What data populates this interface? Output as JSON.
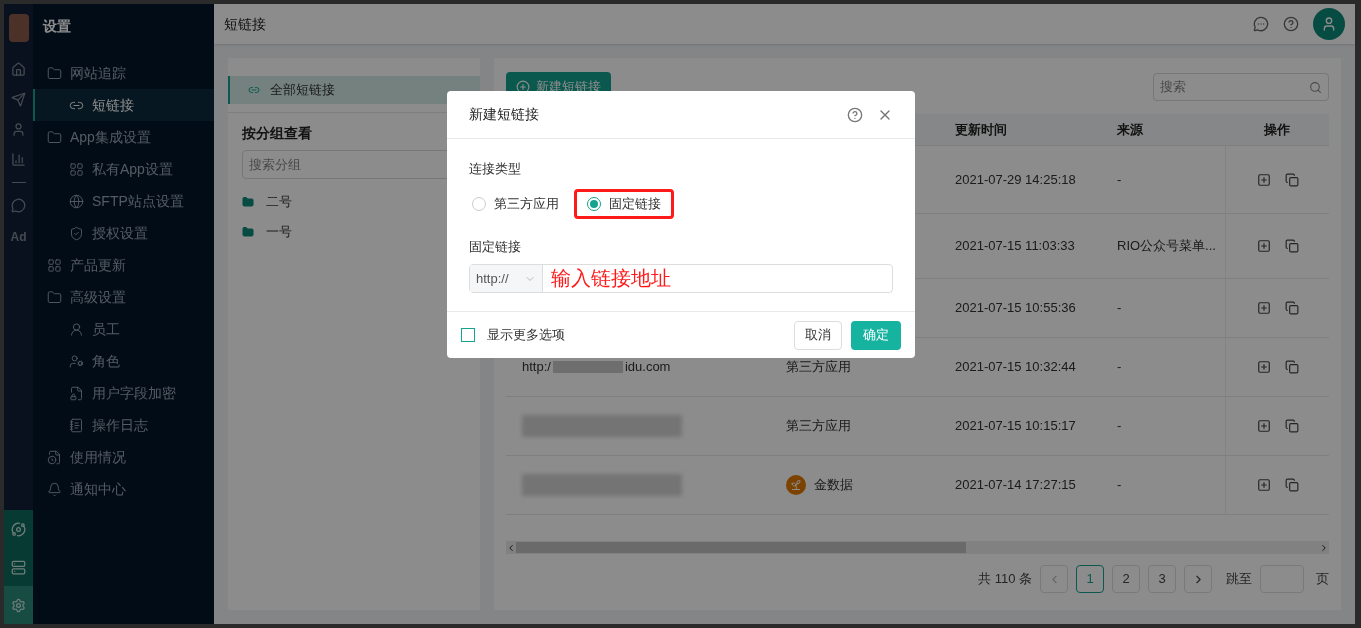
{
  "rail": {
    "ad_label": "Ad",
    "bottom_buttons": [
      {
        "selected": false
      },
      {
        "selected": false
      },
      {
        "selected": true
      }
    ]
  },
  "sidebar": {
    "title": "设置",
    "items": [
      {
        "label": "网站追踪",
        "selected": false,
        "children": [
          {
            "label": "短链接",
            "selected": true
          }
        ]
      },
      {
        "label": "App集成设置",
        "selected": false,
        "children": [
          {
            "label": "私有App设置",
            "selected": false
          },
          {
            "label": "SFTP站点设置",
            "selected": false
          },
          {
            "label": "授权设置",
            "selected": false
          }
        ]
      },
      {
        "label": "产品更新",
        "selected": false
      },
      {
        "label": "高级设置",
        "selected": false,
        "children": [
          {
            "label": "员工",
            "selected": false
          },
          {
            "label": "角色",
            "selected": false
          },
          {
            "label": "用户字段加密",
            "selected": false
          },
          {
            "label": "操作日志",
            "selected": false
          }
        ]
      },
      {
        "label": "使用情况",
        "selected": false
      },
      {
        "label": "通知中心",
        "selected": false
      }
    ]
  },
  "header": {
    "title": "短链接"
  },
  "groups": {
    "all": {
      "label": "全部短链接",
      "selected": true
    },
    "heading": "按分组查看",
    "search_placeholder": "搜索分组",
    "items": [
      {
        "label": "二号"
      },
      {
        "label": "一号"
      }
    ]
  },
  "toolbar": {
    "new_button": "新建短链接",
    "search_placeholder": "搜索"
  },
  "table": {
    "columns": [
      "更新时间",
      "来源",
      "操作"
    ],
    "rows": [
      {
        "link": {
          "kind": "hidden"
        },
        "type": {
          "kind": "hidden"
        },
        "updated": "2021-07-29 14:25:18",
        "source": "-"
      },
      {
        "link": {
          "kind": "hidden"
        },
        "type": {
          "kind": "hidden"
        },
        "updated": "2021-07-15 11:03:33",
        "source": "RIO公众号菜单..."
      },
      {
        "link": {
          "kind": "hidden"
        },
        "type": {
          "kind": "hidden"
        },
        "updated": "2021-07-15 10:55:36",
        "source": "-"
      },
      {
        "link": {
          "kind": "partial",
          "prefix": "http:/",
          "suffix": "idu.com"
        },
        "type": {
          "kind": "text",
          "label": "第三方应用"
        },
        "updated": "2021-07-15 10:32:44",
        "source": "-"
      },
      {
        "link": {
          "kind": "blurred"
        },
        "type": {
          "kind": "text",
          "label": "第三方应用"
        },
        "updated": "2021-07-15 10:15:17",
        "source": "-"
      },
      {
        "link": {
          "kind": "blurred"
        },
        "type": {
          "kind": "app",
          "label": "金数据"
        },
        "updated": "2021-07-14 17:27:15",
        "source": "-"
      }
    ]
  },
  "pagination": {
    "total": "共 110 条",
    "pages": [
      {
        "label": "1",
        "selected": true
      },
      {
        "label": "2",
        "selected": false
      },
      {
        "label": "3",
        "selected": false
      }
    ],
    "jump_label": "跳至",
    "page_suffix": "页"
  },
  "dialog": {
    "title": "新建短链接",
    "type_label": "连接类型",
    "options": [
      {
        "label": "第三方应用",
        "selected": false,
        "highlighted": false
      },
      {
        "label": "固定链接",
        "selected": true,
        "highlighted": true
      }
    ],
    "link_label": "固定链接",
    "protocol": "http://",
    "link_value": "输入链接地址",
    "more_options": {
      "label": "显示更多选项",
      "checked": false
    },
    "cancel": "取消",
    "confirm": "确定"
  }
}
